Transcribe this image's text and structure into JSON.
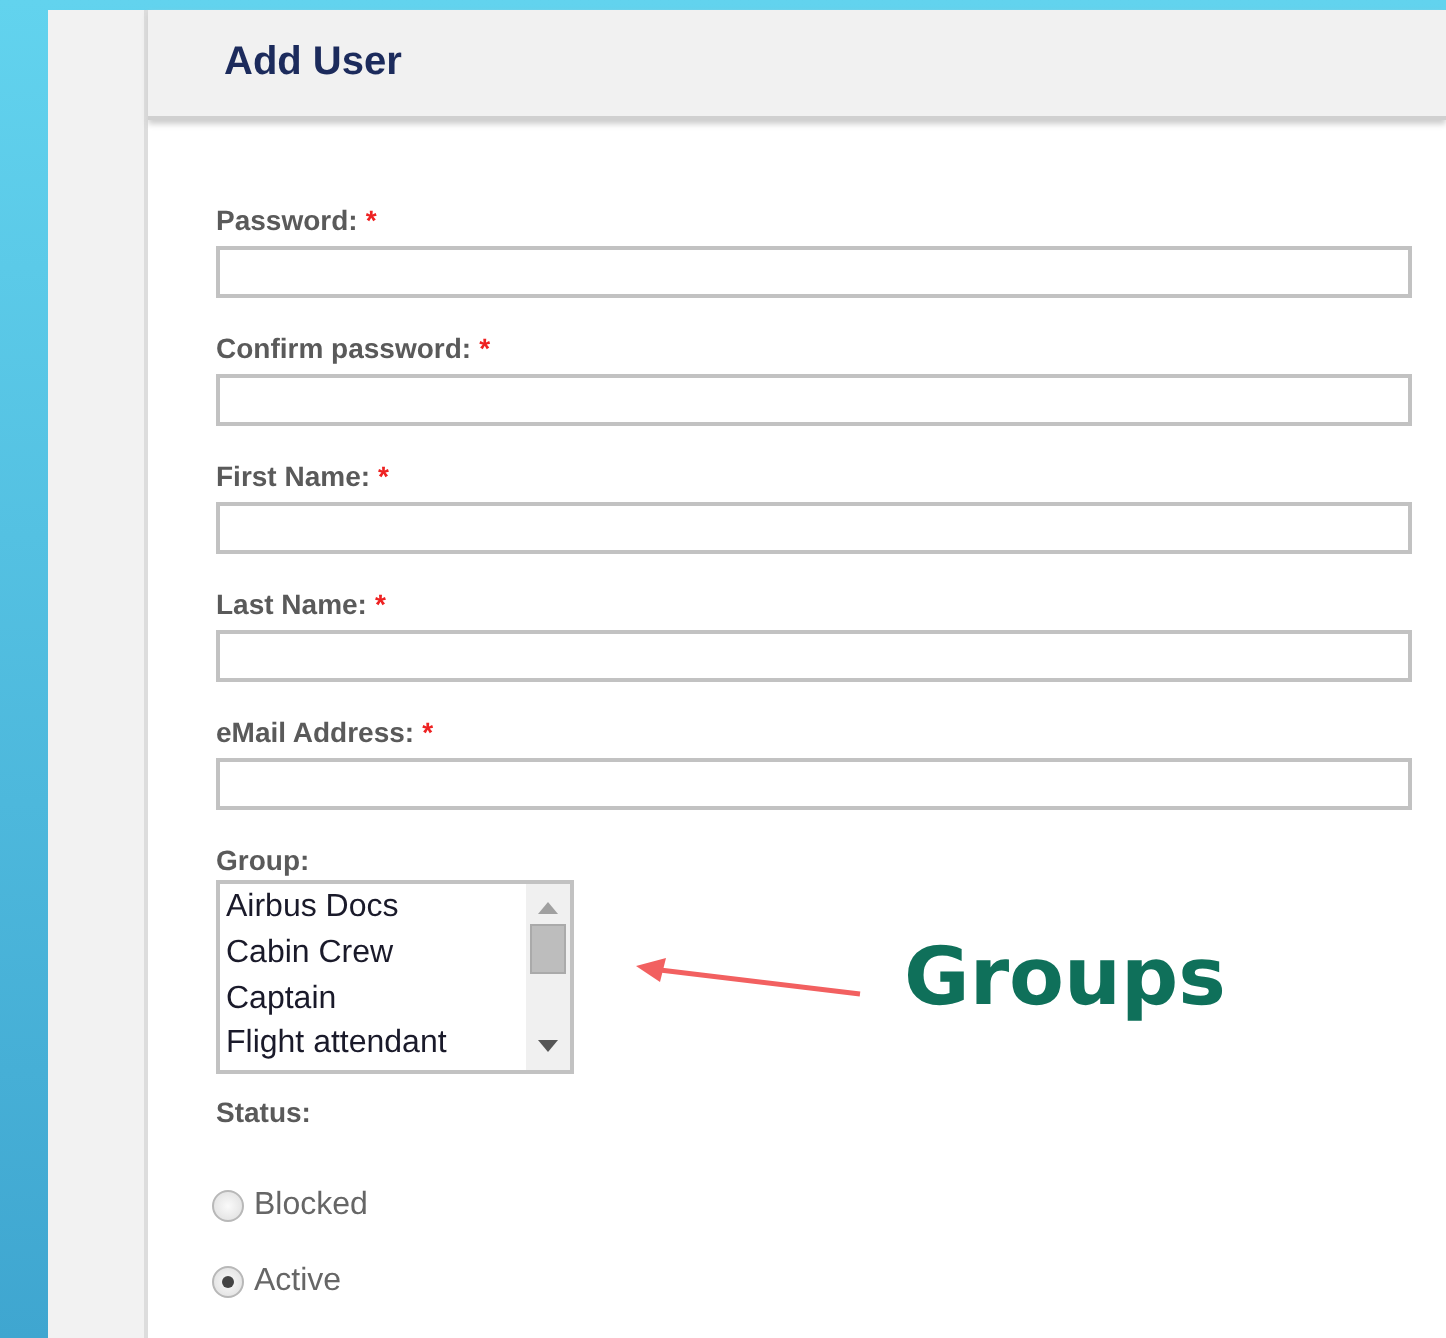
{
  "title": "Add User",
  "required_mark": "*",
  "fields": [
    {
      "label": "Password:",
      "required": true
    },
    {
      "label": "Confirm password:",
      "required": true
    },
    {
      "label": "First Name:",
      "required": true
    },
    {
      "label": "Last Name:",
      "required": true
    },
    {
      "label": "eMail Address:",
      "required": true
    }
  ],
  "group": {
    "label": "Group:",
    "options": [
      {
        "label": "Airbus Docs",
        "selected": false
      },
      {
        "label": "Cabin Crew",
        "selected": false
      },
      {
        "label": "Captain",
        "selected": false
      },
      {
        "label": "Flight attendant",
        "selected": false
      }
    ]
  },
  "status": {
    "label": "Status:",
    "options": [
      {
        "label": "Blocked",
        "selected": false
      },
      {
        "label": "Active",
        "selected": true
      }
    ]
  },
  "annotation": {
    "text": "Groups"
  }
}
